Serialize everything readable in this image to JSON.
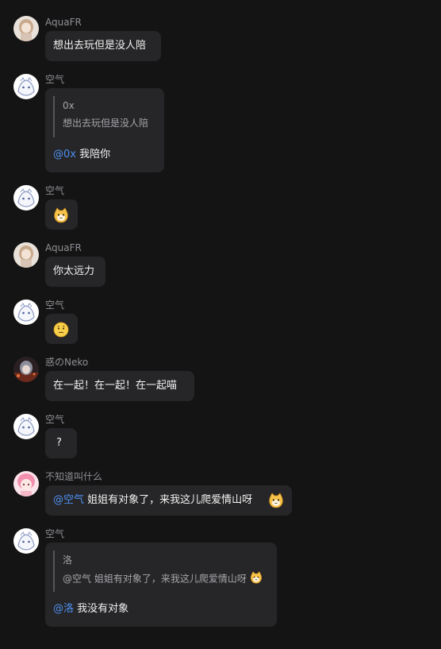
{
  "messages": [
    {
      "sender": "AquaFR",
      "text": "想出去玩但是没人陪"
    },
    {
      "sender": "空气",
      "quote": {
        "author": "0x",
        "text": "想出去玩但是没人陪"
      },
      "mention": "@0x",
      "text": "我陪你"
    },
    {
      "sender": "空气",
      "emoji": "cat-face-emoji"
    },
    {
      "sender": "AquaFR",
      "text": "你太远力"
    },
    {
      "sender": "空气",
      "emoji": "confused-face-emoji"
    },
    {
      "sender": "惑のNeko",
      "text": "在一起！在一起！在一起喵"
    },
    {
      "sender": "空气",
      "text": "?"
    },
    {
      "sender": "不知道叫什么",
      "mention": "@空气",
      "text": "姐姐有对象了，来我这儿爬爱情山呀"
    },
    {
      "sender": "空气",
      "quote": {
        "author": "洛",
        "text": "@空气 姐姐有对象了，来我这儿爬爱情山呀"
      },
      "mention": "@洛",
      "text": "我没有对象"
    }
  ],
  "colors": {
    "background": "#141415",
    "bubble": "#262628",
    "mention": "#4e8ff0",
    "sender_name": "#8f8f94"
  }
}
